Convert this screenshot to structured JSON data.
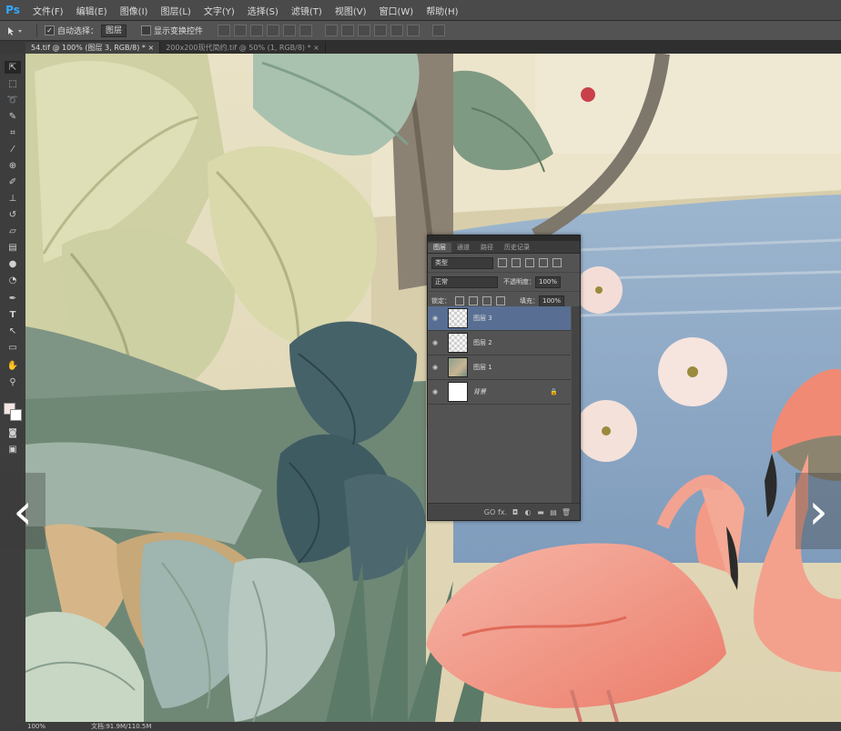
{
  "app": {
    "logo": "Ps"
  },
  "menubar": {
    "items": [
      "文件(F)",
      "编辑(E)",
      "图像(I)",
      "图层(L)",
      "文字(Y)",
      "选择(S)",
      "滤镜(T)",
      "视图(V)",
      "窗口(W)",
      "帮助(H)"
    ]
  },
  "options": {
    "auto_select_label": "自动选择：",
    "auto_select_value": "图层",
    "transform_label": "显示变换控件"
  },
  "tabs": [
    {
      "label": "54.tif @ 100% (图层 3, RGB/8) *",
      "close": "×"
    },
    {
      "label": "200x200现代简约.tif @ 50% (1, RGB/8) *",
      "close": "×"
    }
  ],
  "panel": {
    "tabs": [
      "图层",
      "通道",
      "路径",
      "历史记录"
    ],
    "filter_kind": "类型",
    "blend_mode": "正常",
    "opacity_label": "不透明度：",
    "opacity_value": "100%",
    "lock_label": "锁定：",
    "fill_label": "填充：",
    "fill_value": "100%",
    "layers": [
      {
        "name": "图层 3",
        "selected": true
      },
      {
        "name": "图层 2",
        "selected": false
      },
      {
        "name": "图层 1",
        "selected": false
      },
      {
        "name": "背景",
        "selected": false
      }
    ],
    "bottom_icons": [
      "GO",
      "fx.",
      "◘",
      "◐",
      "▬",
      "▤",
      "🗑"
    ]
  },
  "status": {
    "zoom": "100%",
    "doc": "文档:91.9M/110.5M"
  },
  "nav": {
    "prev": "‹",
    "next": "›"
  }
}
